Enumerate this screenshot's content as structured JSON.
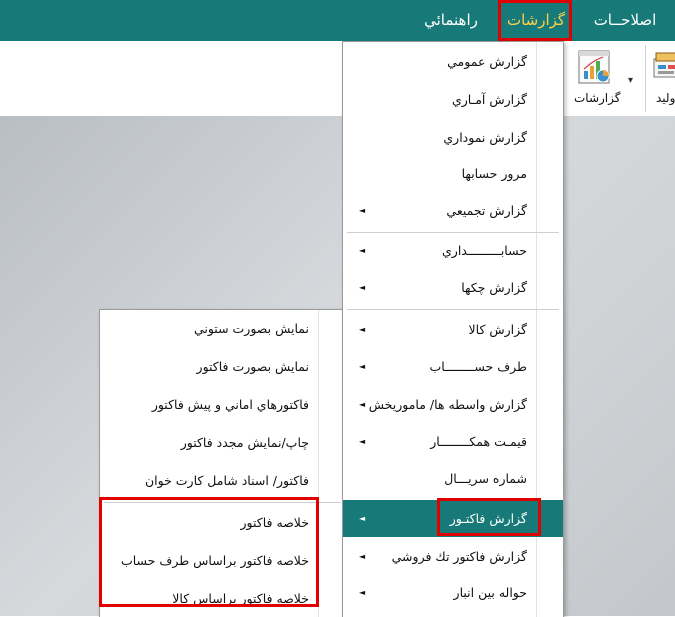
{
  "menubar": {
    "items": [
      {
        "label": "اصلاحــات",
        "id": "edits"
      },
      {
        "label": "گزارشات",
        "id": "reports"
      },
      {
        "label": "راهنمائي",
        "id": "help"
      }
    ]
  },
  "ribbon": {
    "reports_label": "گزارشات",
    "produce_label": "وليد"
  },
  "reports_menu": {
    "items": [
      {
        "label": "گزارش عمومي",
        "submenu": false
      },
      {
        "label": "گزارش آمـاري",
        "submenu": false
      },
      {
        "label": "گزارش نموداري",
        "submenu": false
      },
      {
        "label": "مرور حسابها",
        "submenu": false
      },
      {
        "label": "گزارش تجميعي",
        "submenu": true
      },
      {
        "label": "حسابـــــــــداري",
        "submenu": true
      },
      {
        "label": "گزارش چکها",
        "submenu": true
      },
      {
        "label": "گزارش کالا",
        "submenu": true
      },
      {
        "label": "طرف حســــــــاب",
        "submenu": true
      },
      {
        "label": "گزارش واسطه ها/ ماموريخش",
        "submenu": true
      },
      {
        "label": "قيمـت همکــــــــار",
        "submenu": true
      },
      {
        "label": "شماره سريـــال",
        "submenu": false
      },
      {
        "label": "گزارش فاکتـور",
        "submenu": true,
        "selected": true
      },
      {
        "label": "گزارش فاکتور تك فروشي",
        "submenu": true
      },
      {
        "label": "حواله بين انبار",
        "submenu": true
      }
    ]
  },
  "invoice_submenu": {
    "items": [
      {
        "label": "نمايش بصورت ستوني"
      },
      {
        "label": "نمايش بصورت فاکتور"
      },
      {
        "label": "فاکتورهاي اماني و پيش فاکتور"
      },
      {
        "label": "چاپ/نمايش مجدد فاکتور"
      },
      {
        "label": "فاکتور/ اسناد شامل کارت خوان"
      },
      {
        "label": "خلاصه فاکتور"
      },
      {
        "label": "خلاصه فاکتور براساس طرف حساب"
      },
      {
        "label": "خلاصه فاکتور براساس کالا"
      }
    ]
  },
  "icons": {
    "submenu_arrow": "◄",
    "dropdown_arrow": "▾"
  },
  "colors": {
    "menubar_bg": "#177a78",
    "active_menu_text": "#ffd24a",
    "highlight_border": "#e00000",
    "selected_item_bg": "#177a78"
  }
}
